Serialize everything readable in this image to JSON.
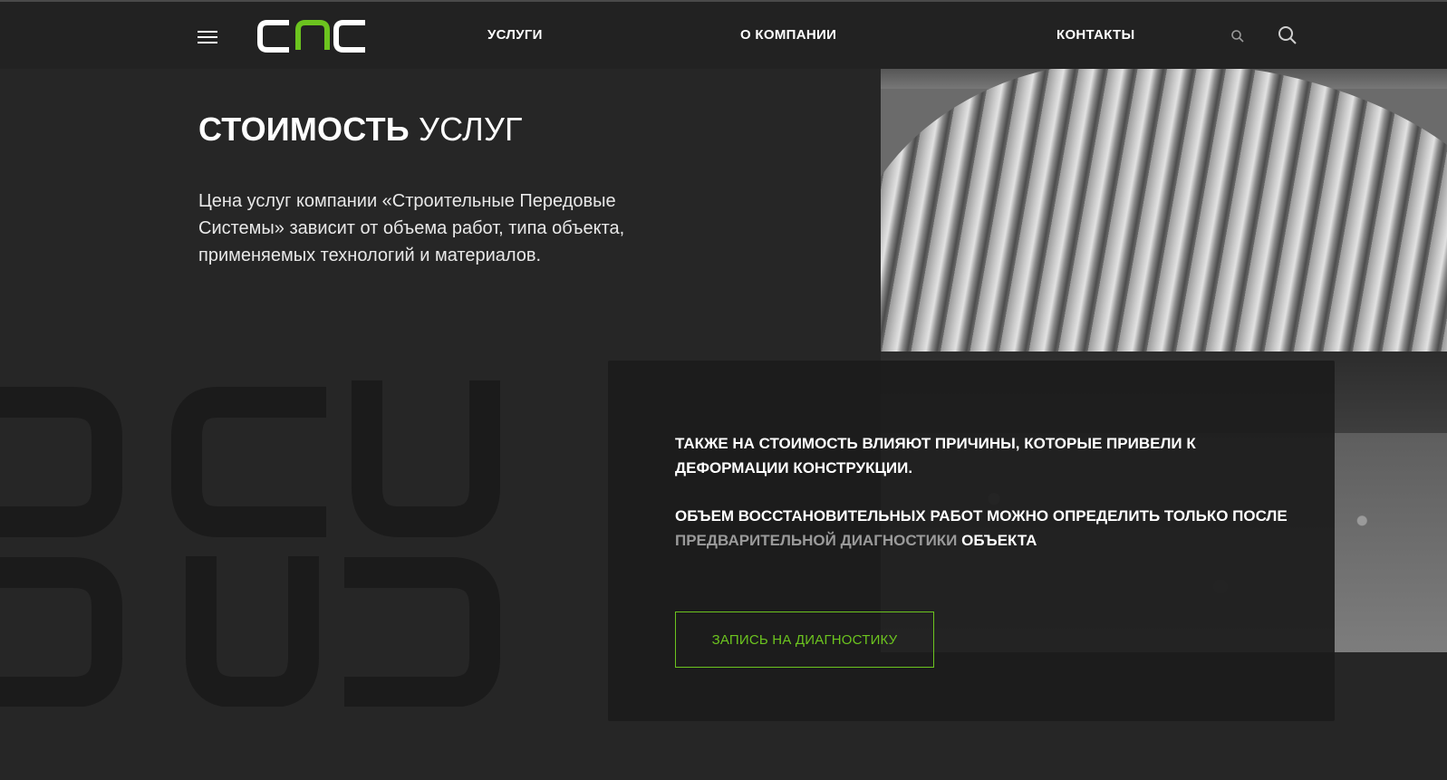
{
  "header": {
    "logo_text": "CNC",
    "nav": [
      {
        "label": "УСЛУГИ"
      },
      {
        "label": "О КОМПАНИИ"
      },
      {
        "label": "КОНТАКТЫ"
      }
    ],
    "icons": [
      "menu-icon",
      "search-icon",
      "search-icon"
    ]
  },
  "hero": {
    "title_bold": "СТОИМОСТЬ",
    "title_rest": " УСЛУГ",
    "lead": "Цена услуг компании «Строительные Передовые Системы» зависит от объема работ, типа объекта, применяемых технологий и материалов."
  },
  "card": {
    "p1": "ТАКЖЕ НА СТОИМОСТЬ ВЛИЯЮТ ПРИЧИНЫ, КОТОРЫЕ ПРИВЕЛИ К ДЕФОРМАЦИИ КОНСТРУКЦИИ.",
    "p2_start": "ОБЪЕМ ВОССТАНОВИТЕЛЬНЫХ РАБОТ МОЖНО ОПРЕДЕЛИТЬ ТОЛЬКО ПОСЛЕ ",
    "p2_highlight": "ПРЕДВАРИТЕЛЬНОЙ ДИАГНОСТИКИ",
    "p2_end": " ОБЪЕКТА",
    "button_label": "ЗАПИСЬ НА ДИАГНОСТИКУ"
  },
  "colors": {
    "accent": "#6cc41f",
    "background": "#262626",
    "header": "#222222",
    "card": "#1c1c1c"
  }
}
